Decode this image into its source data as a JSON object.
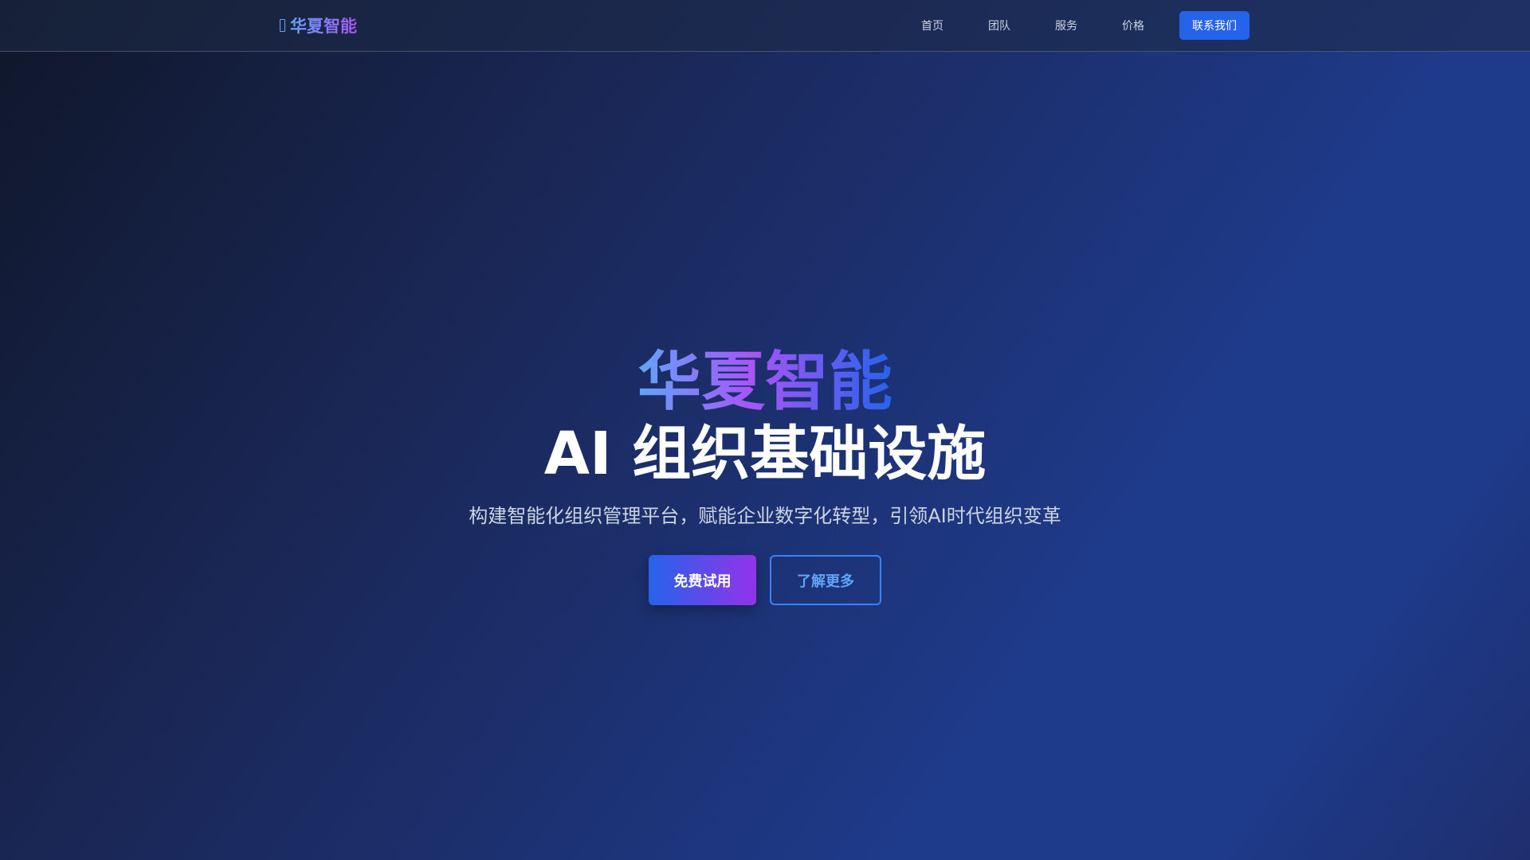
{
  "nav": {
    "logo_text": "华夏智能",
    "logo_icon": "box-icon",
    "links": [
      "首页",
      "团队",
      "服务",
      "价格"
    ],
    "contact_label": "联系我们"
  },
  "hero": {
    "title": "华夏智能",
    "subtitle_main": "AI 组织基础设施",
    "description": "构建智能化组织管理平台，赋能企业数字化转型，引领AI时代组织变革",
    "primary_button": "免费试用",
    "secondary_button": "了解更多"
  },
  "colors": {
    "accent": "#2563eb",
    "gradient_start": "#60a5fa",
    "gradient_end": "#a855f7"
  }
}
